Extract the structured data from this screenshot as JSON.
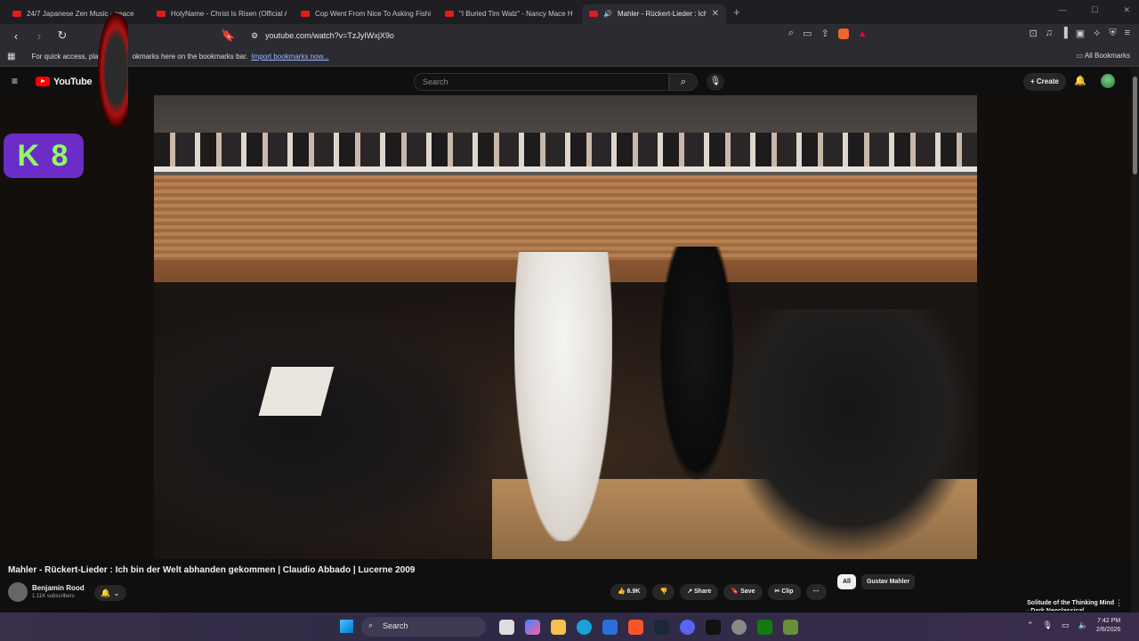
{
  "browser": {
    "tabs": [
      {
        "title": "24/7 Japanese Zen Music - peace"
      },
      {
        "title": "HolyName - Christ Is Risen (Official A"
      },
      {
        "title": "Cop Went From Nice To Asking Fishi"
      },
      {
        "title": "\"I Buried Tim Walz\" - Nancy Mace H"
      },
      {
        "title": "Mahler - Rückert-Lieder : Ich"
      }
    ],
    "url": "youtube.com/watch?v=TzJyIWxjX9o",
    "bookmarks_text": "For quick access, pla",
    "bookmarks_text2": "okmarks here on the bookmarks bar.",
    "import_link": "Import bookmarks now...",
    "all_bookmarks": "All Bookmarks"
  },
  "youtube": {
    "logo": "YouTube",
    "search_placeholder": "Search",
    "create": "Create"
  },
  "overlay": {
    "k8_text": "K 8"
  },
  "video": {
    "title": "Mahler - Rückert-Lieder : Ich bin der Welt abhanden gekommen | Claudio Abbado | Lucerne 2009",
    "channel": "Benjamin Rood",
    "subscribers": "1.11K subscribers",
    "likes": "6.9K",
    "share": "Share",
    "save": "Save",
    "clip": "Clip"
  },
  "chips": [
    "All",
    "Gustav Mahler"
  ],
  "sidebar": {
    "next_title": "Solitude of the Thinking Mind - Dark Neoclassical"
  },
  "taskbar": {
    "search": "Search",
    "time": "7:42 PM",
    "date": "2/6/2026"
  },
  "colors": {
    "yt_red": "#ff0000",
    "k8_bg": "#6b2cc7",
    "k8_text": "#8dff5e"
  }
}
